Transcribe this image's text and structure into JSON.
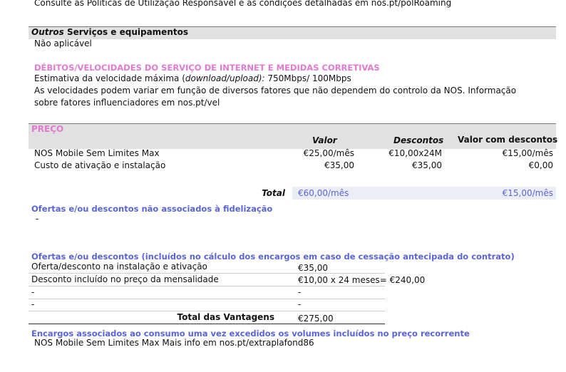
{
  "top_note": "Consulte as Políticas de Utilização Responsável e as condições detalhadas em nos.pt/polRoaming",
  "outros": {
    "title_italic": "Outros",
    "title_rest": " Serviços e equipamentos",
    "value": "Não aplicável"
  },
  "internet": {
    "heading": "DÉBITOS/VELOCIDADES DO SERVIÇO DE INTERNET E MEDIDAS CORRETIVAS",
    "speed_label_a": "Estimativa da velocidade máxima (",
    "speed_label_b": "download/upload):",
    "speed_value": "750Mbps/ 100Mbps",
    "note_line1": "As velocidades podem variar em função de diversos fatores que não dependem do controlo da NOS. Informação",
    "note_line2": "sobre fatores influenciadores em nos.pt/vel"
  },
  "preco": {
    "heading": "PREÇO",
    "col_valor": "Valor",
    "col_descontos": "Descontos",
    "col_valor_desc": "Valor com descontos",
    "rows": [
      {
        "label": "NOS Mobile Sem Limites Max",
        "valor": "€25,00/mês",
        "descontos": "€10,00x24M",
        "valor_desc": "€15,00/mês"
      },
      {
        "label": "Custo de ativação e instalação",
        "valor": "€35,00",
        "descontos": "€35,00",
        "valor_desc": "€0,00"
      }
    ],
    "total_label": "Total",
    "total_valor": "€60,00/mês",
    "total_valor_desc": "€15,00/mês"
  },
  "ofertas_nao_fid": {
    "heading": "Ofertas e/ou descontos não associados à fidelização",
    "value": "-"
  },
  "ofertas_incl": {
    "heading": "Ofertas e/ou descontos (incluídos no cálculo dos encargos em caso de cessação antecipada do contrato)",
    "rows": [
      {
        "label": "Oferta/desconto na instalação e ativação",
        "value": "€35,00"
      },
      {
        "label": "Desconto incluído no preço da mensalidade",
        "value": "€10,00 x 24 meses= €240,00"
      },
      {
        "label": "-",
        "value": "-"
      },
      {
        "label": "-",
        "value": "-"
      }
    ],
    "total_label": "Total das Vantagens",
    "total_value": "€275,00"
  },
  "encargos": {
    "heading": "Encargos associados ao consumo uma vez excedidos os volumes incluídos no preço recorrente",
    "value": "NOS Mobile Sem Limites Max Mais info em nos.pt/extraplafond86"
  }
}
